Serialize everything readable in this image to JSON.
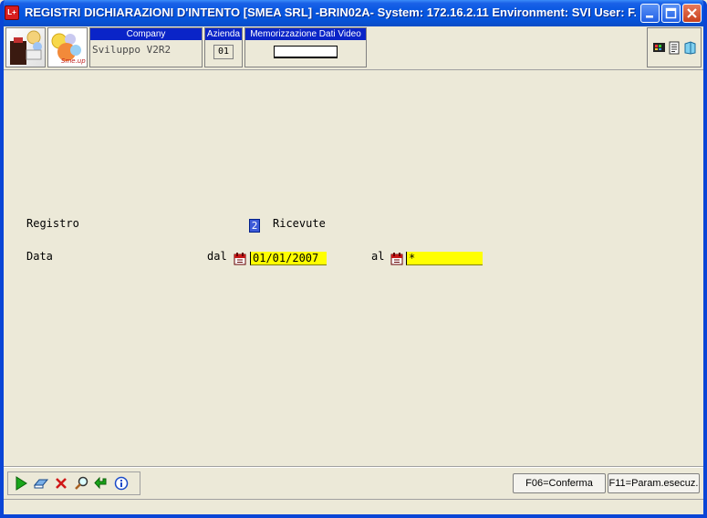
{
  "window": {
    "title": "REGISTRI DICHIARAZIONI D'INTENTO [SMEA SRL] -BRIN02A- System: 172.16.2.11 Environment: SVI User: F...",
    "app_icon_text": "L+"
  },
  "header": {
    "company_label": "Company",
    "company_value": "Sviluppo V2R2",
    "azienda_label": "Azienda",
    "azienda_value": "01",
    "memo_label": "Memorizzazione Dati Video"
  },
  "form": {
    "registro_label": "Registro",
    "registro_code": "2",
    "registro_desc": "Ricevute",
    "data_label": "Data",
    "dal_label": "dal",
    "dal_value": "01/01/2007",
    "al_label": "al",
    "al_value": "*"
  },
  "footer": {
    "f06_label": "F06=Conferma",
    "f11_label": "F11=Param.esecuz."
  },
  "colors": {
    "titlebar": "#0554dc",
    "field_label_bg": "#0a24c8",
    "input_bg": "#ffff00",
    "window_bg": "#ece9d8"
  }
}
